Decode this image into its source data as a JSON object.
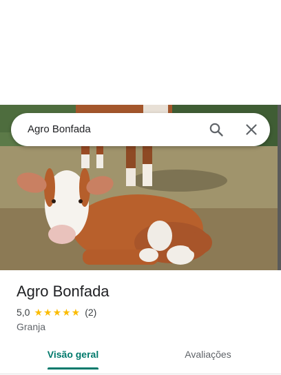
{
  "search": {
    "query": "Agro Bonfada",
    "search_icon": "search-icon",
    "close_icon": "close-icon"
  },
  "place": {
    "name": "Agro Bonfada",
    "rating": "5,0",
    "stars": "★★★★★",
    "review_count": "(2)",
    "category": "Granja"
  },
  "tabs": [
    {
      "label": "Visão geral",
      "active": true
    },
    {
      "label": "Avaliações",
      "active": false
    }
  ],
  "colors": {
    "accent": "#00796b",
    "star": "#fbbc04",
    "text_primary": "#202124",
    "text_secondary": "#5f6368"
  }
}
